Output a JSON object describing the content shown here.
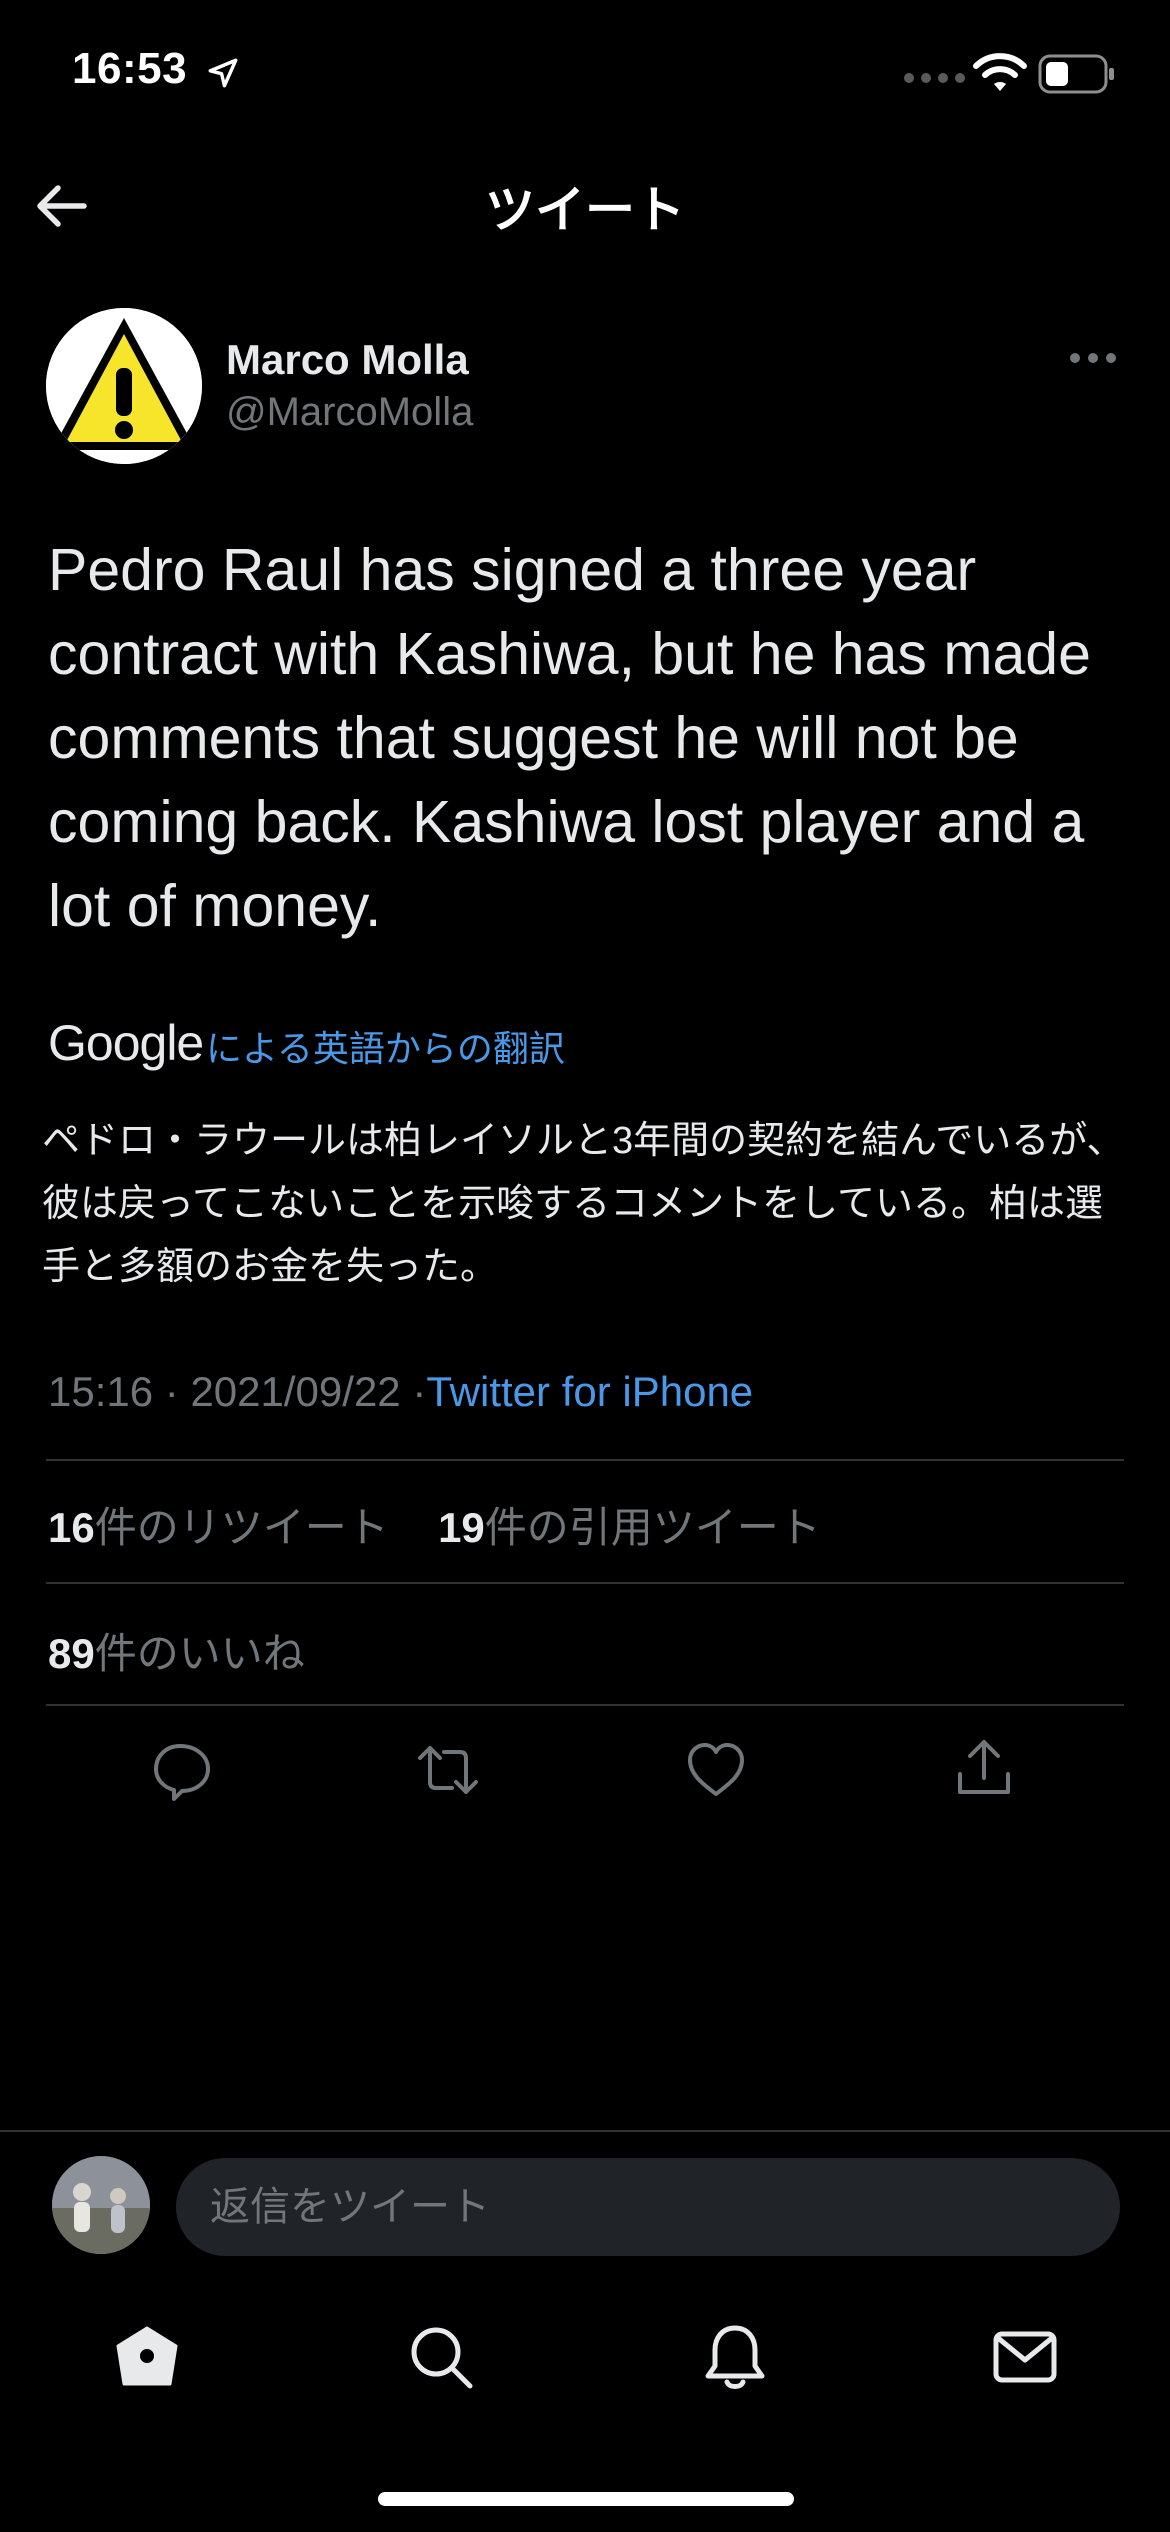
{
  "status_bar": {
    "time": "16:53"
  },
  "header": {
    "title": "ツイート"
  },
  "tweet": {
    "author_name": "Marco Molla",
    "author_handle": "@MarcoMolla",
    "text": "Pedro Raul has signed a three year contract with Kashiwa, but he has made comments that suggest he will not be coming back. Kashiwa lost player and a lot of money.",
    "translation_brand": "Google",
    "translation_label": "による英語からの翻訳",
    "translated_text": "ペドロ・ラウールは柏レイソルと3年間の契約を結んでいるが、彼は戻ってこないことを示唆するコメントをしている。柏は選手と多額のお金を失った。",
    "time": "15:16",
    "date": "2021/09/22",
    "separator": "·",
    "source": "Twitter for iPhone"
  },
  "stats": {
    "retweets_count": "16",
    "retweets_label": "件のリツイート",
    "quotes_count": "19",
    "quotes_label": "件の引用ツイート",
    "likes_count": "89",
    "likes_label": "件のいいね"
  },
  "reply": {
    "placeholder": "返信をツイート"
  },
  "icons": {
    "back": "arrow-left-icon",
    "more": "more-horizontal-icon",
    "reply": "comment-icon",
    "retweet": "retweet-icon",
    "like": "heart-icon",
    "share": "share-icon",
    "home": "home-icon",
    "search": "search-icon",
    "notifications": "bell-icon",
    "messages": "mail-icon"
  },
  "colors": {
    "background": "#000000",
    "text_primary": "#e7e9ea",
    "text_secondary": "#71767b",
    "accent": "#4a99e9",
    "divider": "#2f3336"
  }
}
